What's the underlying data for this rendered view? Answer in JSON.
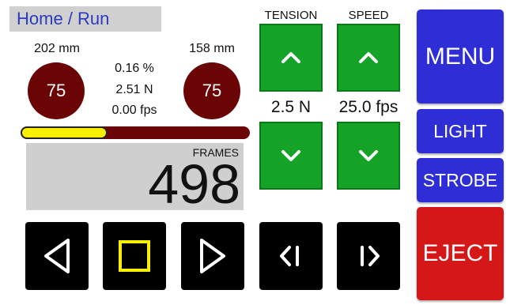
{
  "header": {
    "breadcrumb": "Home / Run"
  },
  "left_reel": {
    "length": "202 mm",
    "value": "75"
  },
  "right_reel": {
    "length": "158 mm",
    "value": "75"
  },
  "stats": {
    "percent": "0.16 %",
    "tension": "2.51 N",
    "fps": "0.00 fps"
  },
  "progress": {
    "fraction": 0.38
  },
  "counter": {
    "label": "FRAMES",
    "value": "498"
  },
  "tension": {
    "header": "TENSION",
    "value": "2.5 N"
  },
  "speed": {
    "header": "SPEED",
    "value": "25.0 fps"
  },
  "side": {
    "menu": "MENU",
    "light": "LIGHT",
    "strobe": "STROBE",
    "eject": "EJECT"
  },
  "colors": {
    "green": "#14a327",
    "blue": "#2f2ed6",
    "red": "#d51717",
    "reel": "#6b0505",
    "progress": "#f8f000",
    "stop": "#f8f000"
  },
  "icons": {
    "rewind": "play-left-icon",
    "stop": "stop-square-icon",
    "play": "play-right-icon",
    "step_back": "step-back-icon",
    "step_forward": "step-forward-icon",
    "up": "chevron-up-icon",
    "down": "chevron-down-icon"
  }
}
